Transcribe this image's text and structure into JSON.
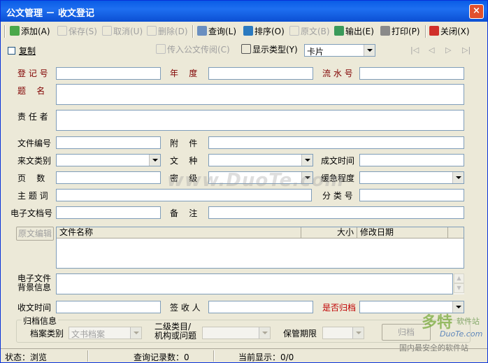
{
  "window": {
    "title": "公文管理 － 收文登记",
    "close": "×"
  },
  "toolbar": {
    "add": "添加(A)",
    "save": "保存(S)",
    "cancel": "取消(U)",
    "delete": "删除(D)",
    "query": "查询(L)",
    "sort": "排序(O)",
    "original": "原文(B)",
    "export": "输出(E)",
    "print": "打印(P)",
    "close": "关闭(X)"
  },
  "row2": {
    "copy_label": "复制",
    "transfer": "传入公文传阅(C)",
    "display_type_label": "显示类型(Y)",
    "display_type_value": "卡片",
    "nav": [
      "|◁",
      "◁",
      "▷",
      "▷|"
    ]
  },
  "fields": {
    "reg_no": "登 记 号",
    "year": "年    度",
    "serial_no": "流 水 号",
    "title": "题    名",
    "responsible": "责 任 者",
    "doc_no": "文件编号",
    "attachment": "附    件",
    "source_type": "来文类别",
    "doc_kind": "文    种",
    "created_time": "成文时间",
    "pages": "页    数",
    "secret_level": "密    级",
    "urgency": "缓急程度",
    "subject": "主 题 词",
    "category_no": "分 类 号",
    "edoc_no": "电子文档号",
    "remark": "备    注",
    "edoc_bg": "电子文件\n背景信息",
    "receive_time": "收文时间",
    "signer": "签 收 人",
    "is_archived": "是否归档"
  },
  "file_grid": {
    "edit_button": "原文编辑",
    "columns": [
      "文件名称",
      "大小",
      "修改日期"
    ]
  },
  "archive": {
    "group_label": "归档信息",
    "type_label": "档案类别",
    "type_value": "文书档案",
    "sub_label": "二级类目/\n机构或问题",
    "period_label": "保管期限",
    "archive_button": "归档"
  },
  "status": {
    "state": "状态：浏览",
    "query_count": "查询记录数：0",
    "current": "当前显示：0/0"
  },
  "watermark": "www.DuoTe.com",
  "logo": {
    "text": "多特",
    "sub": "软件站",
    "url": "DuoTe.com",
    "slogan": "国内最安全的软件站"
  }
}
